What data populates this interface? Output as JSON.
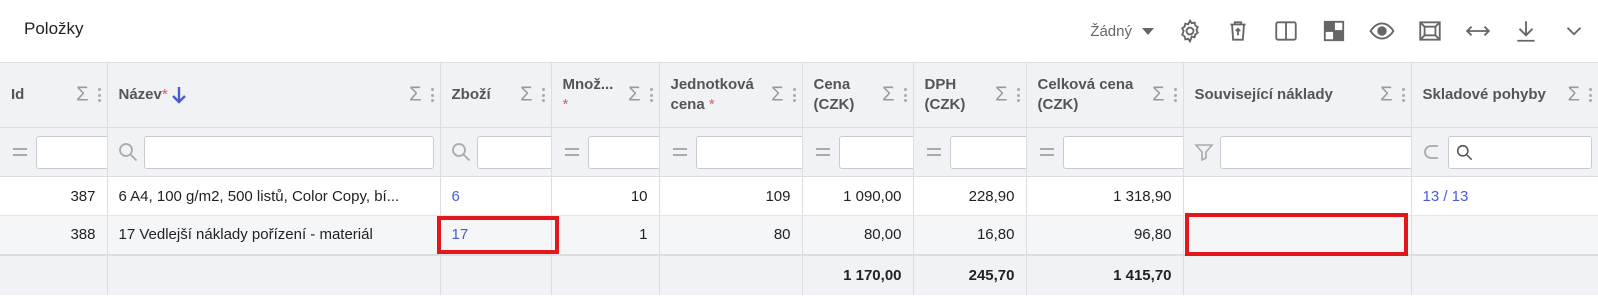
{
  "title": "Položky",
  "toolbar": {
    "view_select": "Žádný",
    "icons": [
      "gear-icon",
      "delete-icon",
      "columns-icon",
      "layout-icon",
      "eye-icon",
      "fit-icon",
      "expand-width-icon",
      "download-icon",
      "chevron-down-icon"
    ]
  },
  "columns": [
    {
      "label": "Id",
      "required": false
    },
    {
      "label": "Název",
      "required": true,
      "sorted": "desc"
    },
    {
      "label": "Zboží",
      "required": false
    },
    {
      "label": "Množ...",
      "required": true
    },
    {
      "label": "Jednotková cena",
      "required": true
    },
    {
      "label": "Cena (CZK)",
      "required": false
    },
    {
      "label": "DPH (CZK)",
      "required": false
    },
    {
      "label": "Celková cena (CZK)",
      "required": false
    },
    {
      "label": "Související náklady",
      "required": false
    },
    {
      "label": "Skladové pohyby",
      "required": false
    }
  ],
  "required_mark": "*",
  "sum_symbol": "Σ",
  "rows": [
    {
      "id": "387",
      "nazev": "6 A4, 100 g/m2, 500 listů, Color Copy, bí...",
      "zbozi": "6",
      "mnozstvi": "10",
      "jedn_cena": "109",
      "cena": "1 090,00",
      "dph": "228,90",
      "celkem": "1 318,90",
      "souvisejici": "",
      "pohyby": "13 / 13"
    },
    {
      "id": "388",
      "nazev": "17 Vedlejší náklady pořízení - materiál",
      "zbozi": "17",
      "mnozstvi": "1",
      "jedn_cena": "80",
      "cena": "80,00",
      "dph": "16,80",
      "celkem": "96,80",
      "souvisejici": "",
      "pohyby": ""
    }
  ],
  "totals": {
    "cena": "1 170,00",
    "dph": "245,70",
    "celkem": "1 415,70"
  },
  "colors": {
    "link": "#4b5bd6",
    "highlight": "#e0181b",
    "header_bg": "#f1f2f5",
    "required": "#e05a5a"
  }
}
